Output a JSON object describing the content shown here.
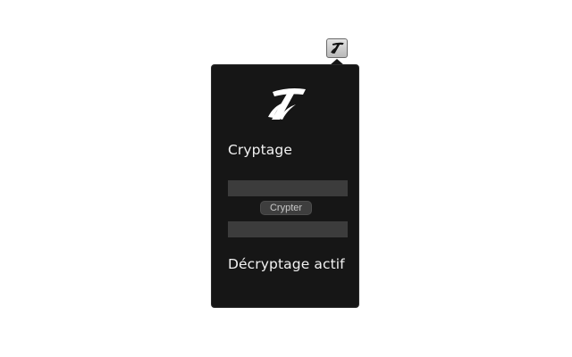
{
  "toolbar": {
    "extension_icon": "stylized-t-logo-icon"
  },
  "popup": {
    "logo_icon": "stylized-t-logo-icon",
    "encrypt_title": "Cryptage",
    "input_value": "",
    "encrypt_button_label": "Crypter",
    "output_value": "",
    "decrypt_title": "Décryptage actif"
  },
  "colors": {
    "popup_background": "#161616",
    "field_background": "#3c3c3c",
    "button_background": "#3e3e3e",
    "title_text": "#f2f2f2"
  }
}
